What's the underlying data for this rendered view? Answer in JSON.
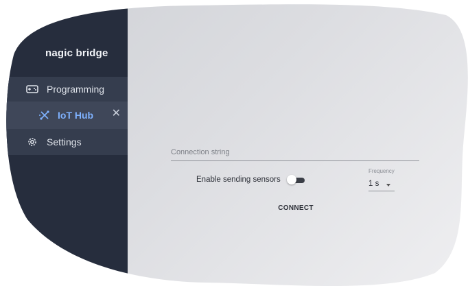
{
  "brand": {
    "name": "nagic bridge"
  },
  "sidebar": {
    "items": [
      {
        "label": "Programming",
        "icon": "gamepad-icon"
      },
      {
        "label": "IoT Hub",
        "icon": "iot-hub-icon",
        "close": "✕",
        "active": true
      },
      {
        "label": "Settings",
        "icon": "gear-icon"
      }
    ]
  },
  "main": {
    "connection_string": {
      "placeholder": "Connection string",
      "value": ""
    },
    "enable_sensors": {
      "label": "Enable sending sensors",
      "enabled": false
    },
    "frequency": {
      "label": "Frequency",
      "value": "1 s"
    },
    "connect_button": "CONNECT"
  },
  "colors": {
    "sidebar_bg": "#262d3d",
    "active_item": "#7fb2ff",
    "panel_bg": "#dcdde1"
  }
}
